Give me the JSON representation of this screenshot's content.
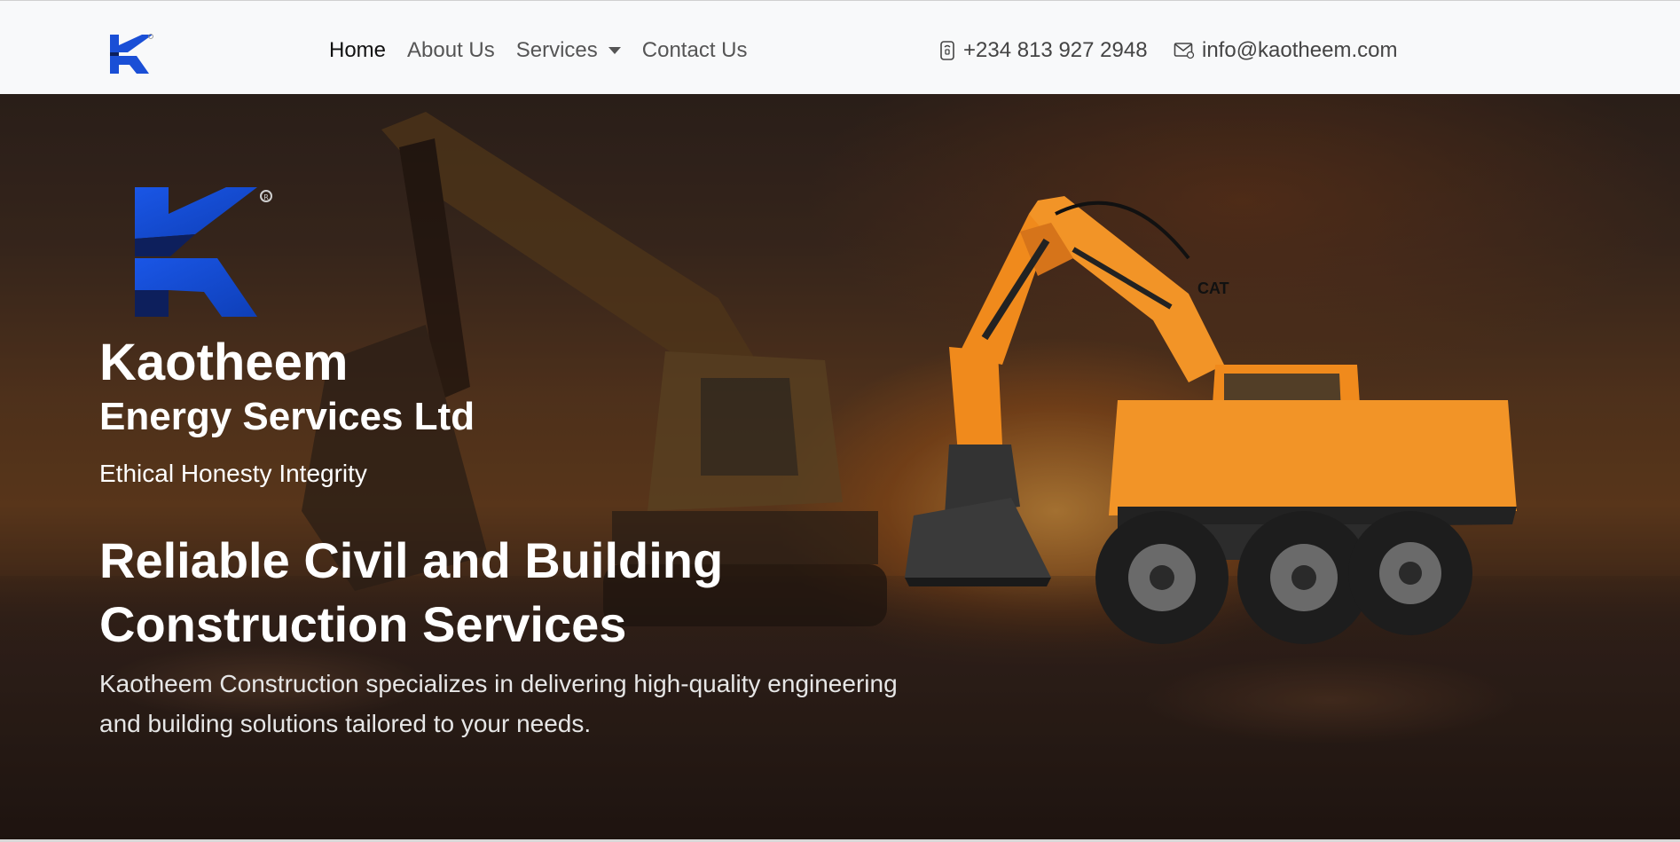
{
  "nav": {
    "logo_alt": "Kaotheem logo",
    "links": [
      {
        "label": "Home",
        "active": true
      },
      {
        "label": "About Us",
        "active": false
      },
      {
        "label": "Services",
        "active": false,
        "dropdown": true
      },
      {
        "label": "Contact Us",
        "active": false
      }
    ],
    "phone": "+234 813 927 2948",
    "phone_icon": "phone-icon",
    "email": "info@kaotheem.com",
    "email_icon": "envelope-icon"
  },
  "hero": {
    "brand_name": "Kaotheem",
    "brand_sub": "Energy Services Ltd",
    "tagline": "Ethical Honesty Integrity",
    "headline": "Reliable Civil and Building Construction Services",
    "description": "Kaotheem Construction specializes in delivering high-quality engineering and building solutions tailored to your needs."
  },
  "colors": {
    "brand_blue": "#1a4fd6",
    "brand_navy": "#0d1f5c",
    "excavator_orange": "#f08a1c",
    "navbar_bg": "#f8f9fa"
  }
}
